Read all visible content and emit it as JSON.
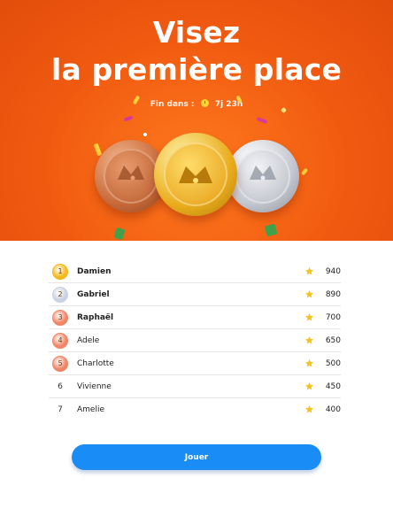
{
  "hero": {
    "title_line1": "Visez",
    "title_line2": "la première place",
    "timer_label": "Fin dans :",
    "timer_value": "7j 23h"
  },
  "leaderboard": [
    {
      "rank": "1",
      "name": "Damien",
      "score": "940",
      "badge": "gold",
      "bold": true
    },
    {
      "rank": "2",
      "name": "Gabriel",
      "score": "890",
      "badge": "silver",
      "bold": true
    },
    {
      "rank": "3",
      "name": "Raphaël",
      "score": "700",
      "badge": "bronze",
      "bold": true
    },
    {
      "rank": "4",
      "name": "Adele",
      "score": "650",
      "badge": "bronze",
      "bold": false
    },
    {
      "rank": "5",
      "name": "Charlotte",
      "score": "500",
      "badge": "bronze",
      "bold": false
    },
    {
      "rank": "6",
      "name": "Vivienne",
      "score": "450",
      "badge": "none",
      "bold": false
    },
    {
      "rank": "7",
      "name": "Amelie",
      "score": "400",
      "badge": "none",
      "bold": false
    }
  ],
  "play_button": {
    "label": "Jouer"
  },
  "colors": {
    "hero_bg": "#f05a10",
    "button": "#1a8cf5",
    "gold": "#f5b81c",
    "silver": "#c9d2e0",
    "bronze": "#f08466",
    "star": "#f7c21a"
  }
}
